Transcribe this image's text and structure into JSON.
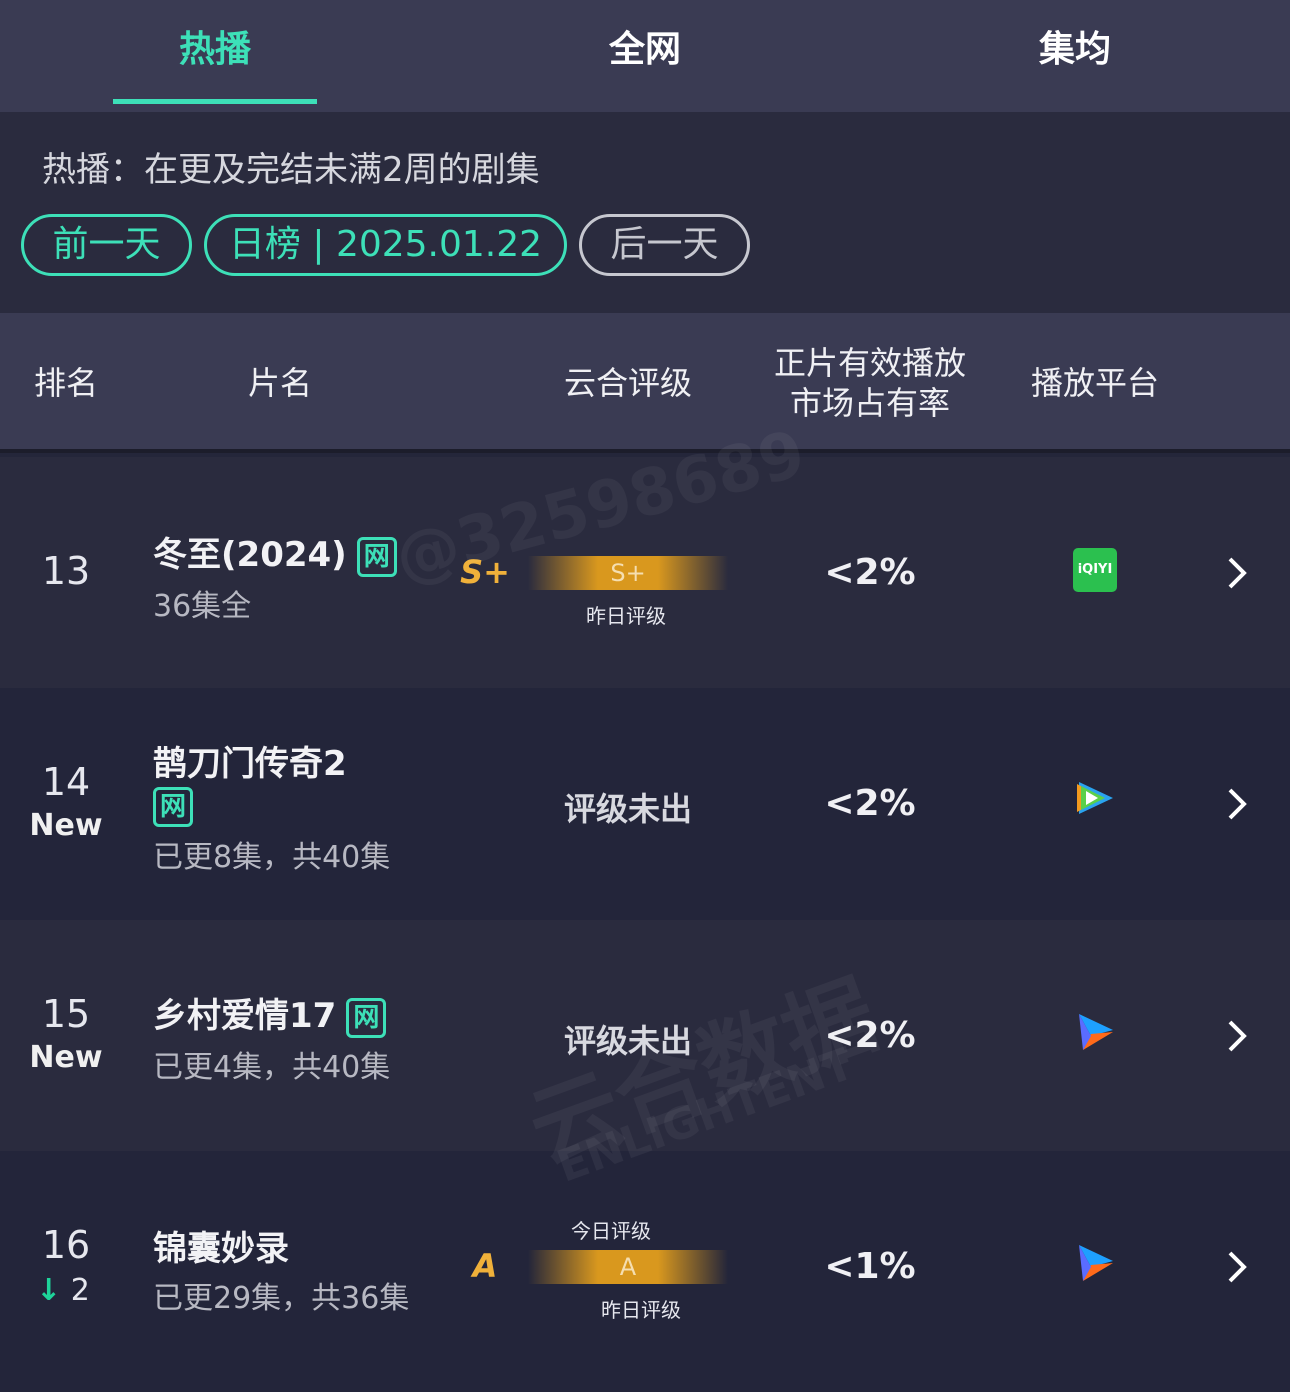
{
  "tabs": [
    {
      "label": "热播",
      "active": true
    },
    {
      "label": "全网"
    },
    {
      "label": "集均"
    }
  ],
  "filter": {
    "description": "热播：在更及完结未满2周的剧集",
    "prev_label": "前一天",
    "date_label": "日榜 | 2025.01.22",
    "next_label": "后一天"
  },
  "table": {
    "headers": [
      "排名",
      "片名",
      "云合评级",
      "正片有效播放\n市场占有率",
      "播放平台"
    ],
    "rows": [
      {
        "rank": "13",
        "change": "",
        "title": "冬至(2024)",
        "tag": "网",
        "episodes": "36集全",
        "grade": "S+",
        "bar_grade": "S+",
        "yesterday_label": "昨日评级",
        "share": "<2%",
        "platform": "iqiyi-icon",
        "platform_text": "iQIYI"
      },
      {
        "rank": "14",
        "change": "New",
        "title": "鹊刀门传奇2",
        "tag": "网",
        "episodes": "已更8集，共40集",
        "rating_status": "评级未出",
        "share": "<2%",
        "platform": "tencent-video-icon"
      },
      {
        "rank": "15",
        "change": "New",
        "title": "乡村爱情17",
        "tag": "网",
        "episodes": "已更4集，共40集",
        "rating_status": "评级未出",
        "share": "<2%",
        "platform": "youku-icon"
      },
      {
        "rank": "16",
        "change": "2",
        "change_dir": "down",
        "title": "锦囊妙录",
        "episodes": "已更29集，共36集",
        "grade": "A",
        "bar_grade": "A",
        "today_label": "今日评级",
        "yesterday_label": "昨日评级",
        "share": "<1%",
        "platform": "youku-icon"
      }
    ]
  },
  "watermark": {
    "id": "@32598689",
    "brand": "云合数据",
    "brand_en": "ENLIGHTENT"
  },
  "colors": {
    "accent": "#3de0b8",
    "grade": "#f0b13a",
    "iqiyi": "#2bc04f"
  }
}
